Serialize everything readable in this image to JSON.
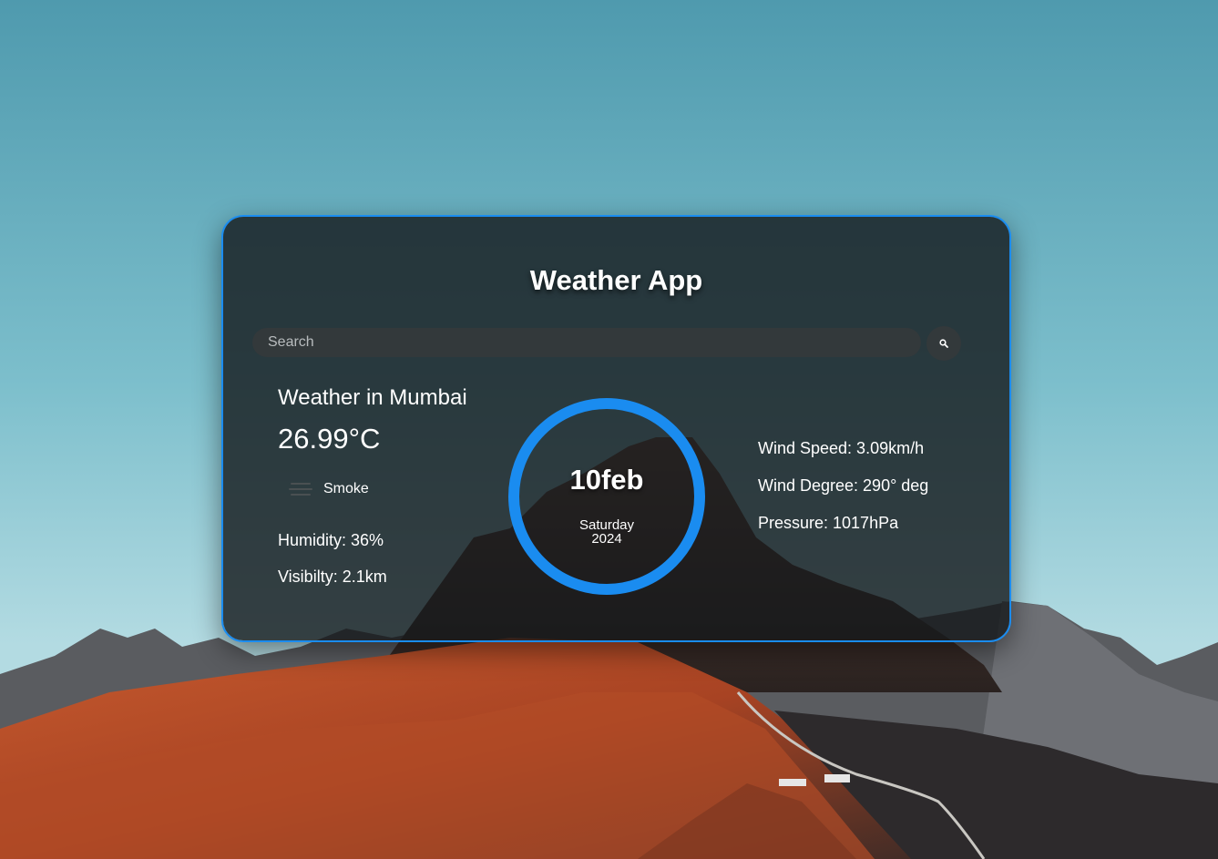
{
  "app": {
    "title": "Weather App"
  },
  "search": {
    "placeholder": "Search",
    "button_icon": "search-icon"
  },
  "weather": {
    "city_heading": "Weather in Mumbai",
    "temperature": "26.99°C",
    "condition": "Smoke",
    "condition_icon": "smoke-icon",
    "humidity": "Humidity: 36%",
    "visibility": "Visibilty: 2.1km"
  },
  "date": {
    "day_month": "10feb",
    "weekday": "Saturday",
    "year": "2024"
  },
  "details": {
    "wind_speed": "Wind Speed: 3.09km/h",
    "wind_degree": "Wind Degree: 290° deg",
    "pressure": "Pressure: 1017hPa"
  },
  "colors": {
    "accent": "#1a8cf0",
    "card_bg": "#1c2224",
    "input_bg": "#33393b",
    "text": "#ffffff"
  }
}
